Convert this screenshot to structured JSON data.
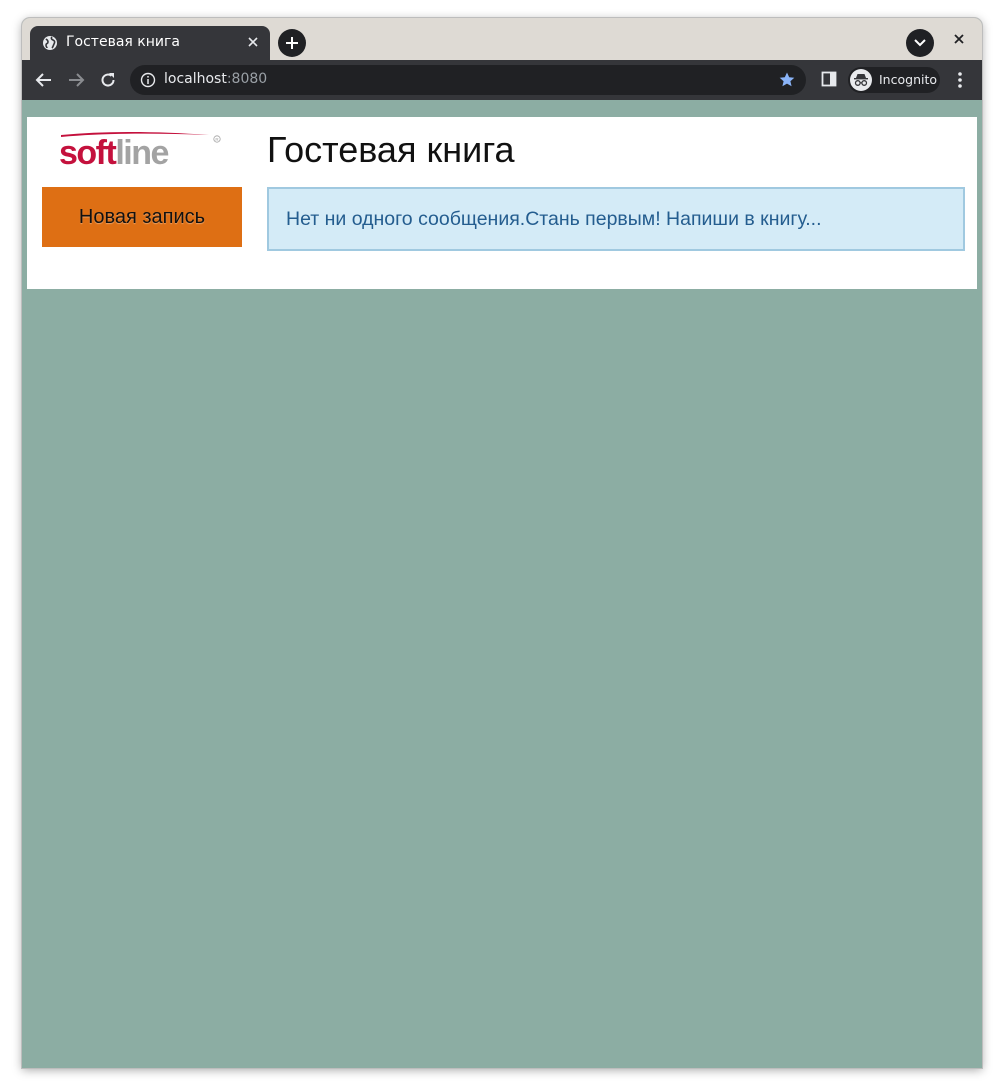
{
  "browser": {
    "tab": {
      "title": "Гостевая книга",
      "favicon": "globe-icon"
    },
    "address_bar": {
      "host": "localhost",
      "port": ":8080",
      "bookmarked": true
    },
    "profile": {
      "label": "Incognito",
      "icon": "incognito-icon"
    },
    "colors": {
      "tab_strip": "#dedad4",
      "toolbar": "#35363a",
      "star": "#8ab4f8"
    }
  },
  "page": {
    "logo_text": "softline",
    "title": "Гостевая книга",
    "new_entry_button": "Новая запись",
    "empty_message": "Нет ни одного сообщения.Стань первым! Напиши в книгу...",
    "colors": {
      "background": "#8cada3",
      "button": "#de6f14",
      "alert_bg": "#d4ebf7",
      "alert_text": "#245d8f",
      "logo_red": "#c4113d",
      "logo_gray": "#a3a3a3"
    }
  }
}
